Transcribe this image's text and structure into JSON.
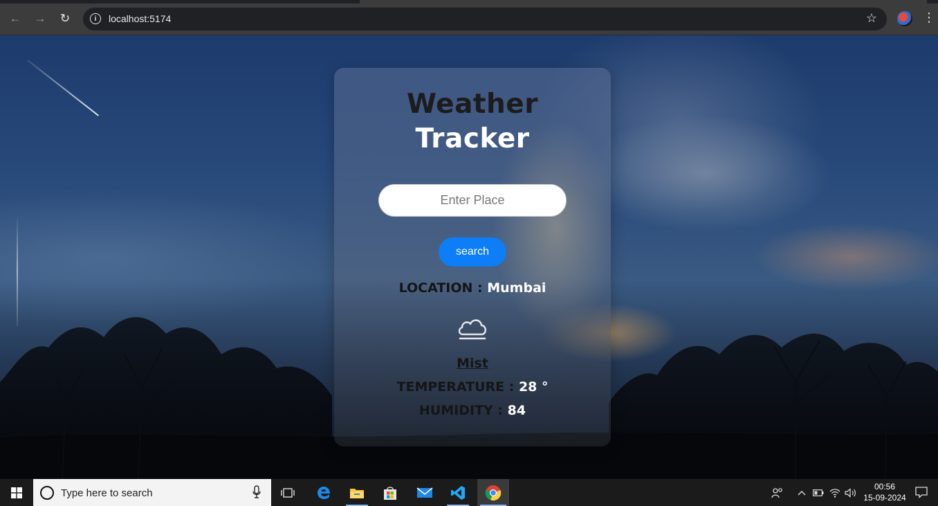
{
  "browser": {
    "url": "localhost:5174"
  },
  "app": {
    "title_line1": "Weather",
    "title_line2": "Tracker",
    "input_placeholder": "Enter Place",
    "search_label": "search",
    "location_label": "LOCATION : ",
    "location_value": "Mumbai",
    "weather_icon": "cloud-mist-icon",
    "condition": "Mist",
    "temperature_label": "TEMPERATURE : ",
    "temperature_value": "28 °",
    "humidity_label": "HUMIDITY : ",
    "humidity_value": "84",
    "colors": {
      "button": "#0d7ef7",
      "label_text": "#151515",
      "value_text": "#ffffff"
    }
  },
  "taskbar": {
    "search_placeholder": "Type here to search",
    "time": "00:56",
    "date": "15-09-2024",
    "pinned": [
      "task-view-icon",
      "edge-icon",
      "file-explorer-icon",
      "store-icon",
      "mail-icon",
      "vscode-icon",
      "chrome-icon"
    ]
  }
}
